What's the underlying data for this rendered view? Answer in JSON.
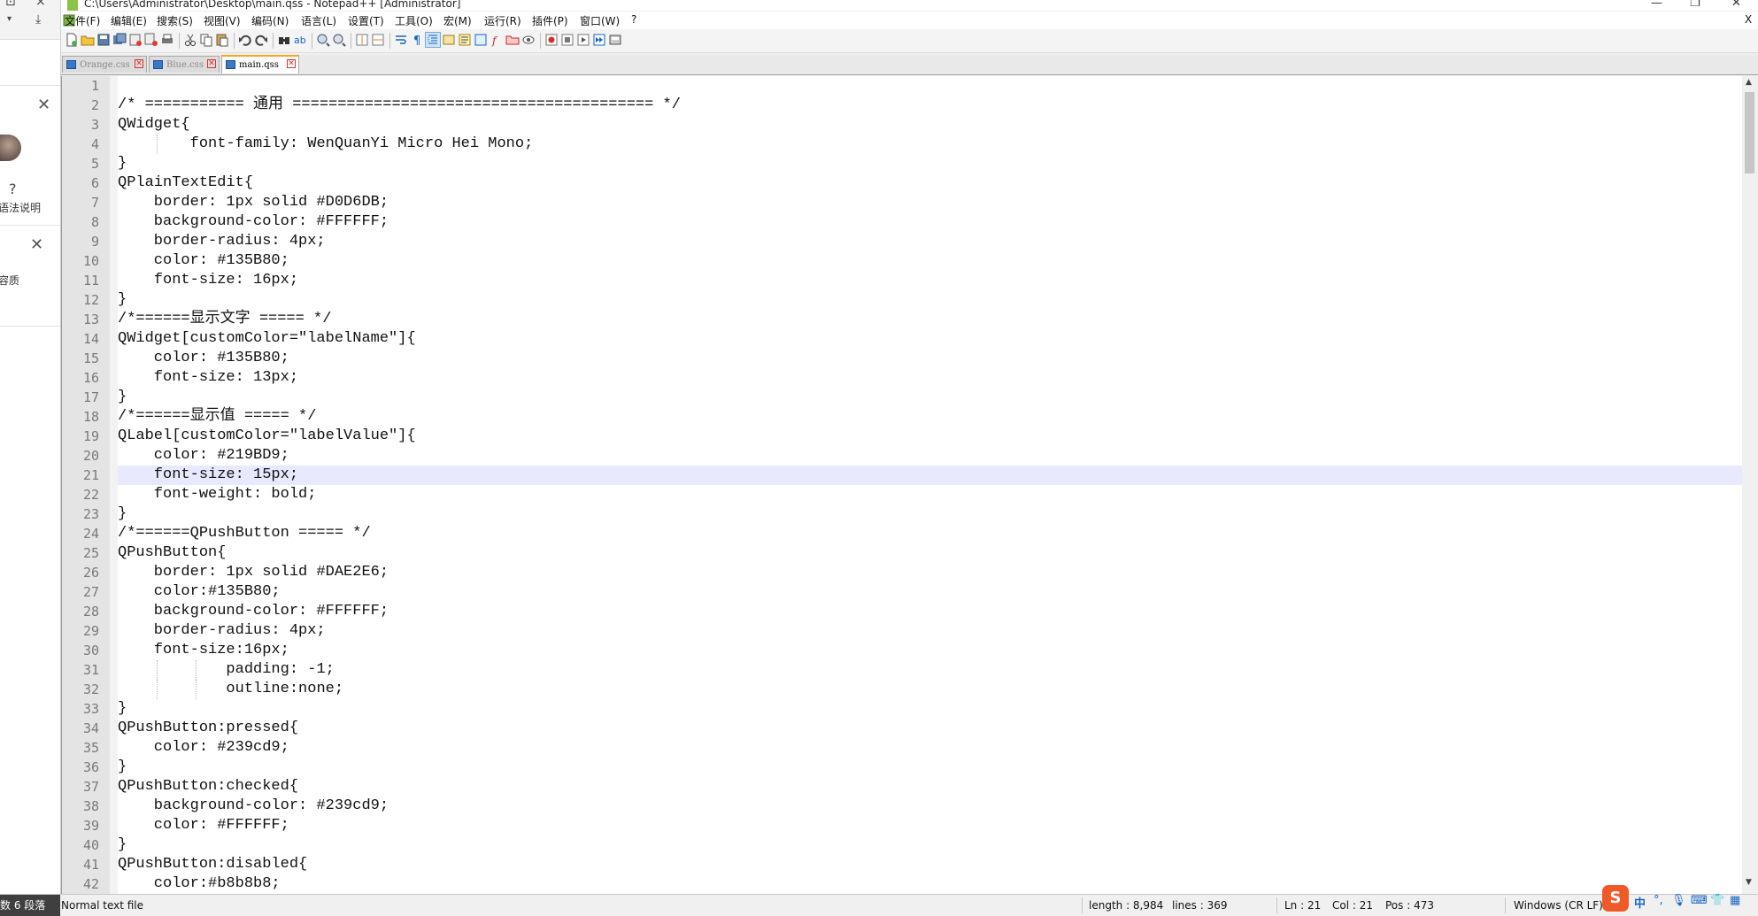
{
  "window": {
    "title": "C:\\Users\\Administrator\\Desktop\\main.qss - Notepad++ [Administrator]",
    "minimize": "—",
    "maximize": "❐",
    "close": "✕"
  },
  "menu": [
    "文件(F)",
    "编辑(E)",
    "搜索(S)",
    "视图(V)",
    "编码(N)",
    "语言(L)",
    "设置(T)",
    "工具(O)",
    "宏(M)",
    "运行(R)",
    "插件(P)",
    "窗口(W)",
    "?"
  ],
  "menu_close": "X",
  "tabs": [
    {
      "label": "Orange.css",
      "active": false
    },
    {
      "label": "Blue.css",
      "active": false
    },
    {
      "label": "main.qss",
      "active": true
    }
  ],
  "editor": {
    "current_line": 21,
    "lines": [
      "",
      "/* =========== 通用 ======================================== */",
      "QWidget{",
      "\t\tfont-family: WenQuanYi Micro Hei Mono;",
      "}",
      "QPlainTextEdit{",
      "    border: 1px solid #D0D6DB;",
      "    background-color: #FFFFFF;",
      "    border-radius: 4px;",
      "    color: #135B80;",
      "    font-size: 16px;",
      "}",
      "/*======显示文字 ===== */",
      "QWidget[customColor=\"labelName\"]{",
      "    color: #135B80;",
      "    font-size: 13px;",
      "}",
      "/*======显示值 ===== */",
      "QLabel[customColor=\"labelValue\"]{",
      "    color: #219BD9;",
      "    font-size: 15px;",
      "    font-weight: bold;",
      "}",
      "/*======QPushButton ===== */",
      "QPushButton{",
      "    border: 1px solid #DAE2E6;",
      "    color:#135B80;",
      "    background-color: #FFFFFF;",
      "    border-radius: 4px;",
      "    font-size:16px;",
      "\t\t\tpadding: -1;",
      "\t\t\toutline:none;",
      "}",
      "QPushButton:pressed{",
      "    color: #239cd9;",
      "}",
      "QPushButton:checked{",
      "    background-color: #239cd9;",
      "    color: #FFFFFF;",
      "}",
      "QPushButton:disabled{",
      "    color:#b8b8b8;"
    ]
  },
  "status": {
    "left_panel": "数 6 段落",
    "file_type": "Normal text file",
    "length": "length : 8,984",
    "lines": "lines : 369",
    "ln": "Ln : 21",
    "col": "Col : 21",
    "pos": "Pos : 473",
    "eol": "Windows (CR LF)"
  },
  "left_window": {
    "help_label": "语法说明",
    "content_label": "容质",
    "close_glyph": "✕"
  },
  "ime": {
    "logo": "S",
    "lang": "中"
  },
  "colors": {
    "active_tab_accent": "#f5a623",
    "current_line_bg": "#e8e8ff",
    "gutter_bg": "#e4e4e4"
  }
}
